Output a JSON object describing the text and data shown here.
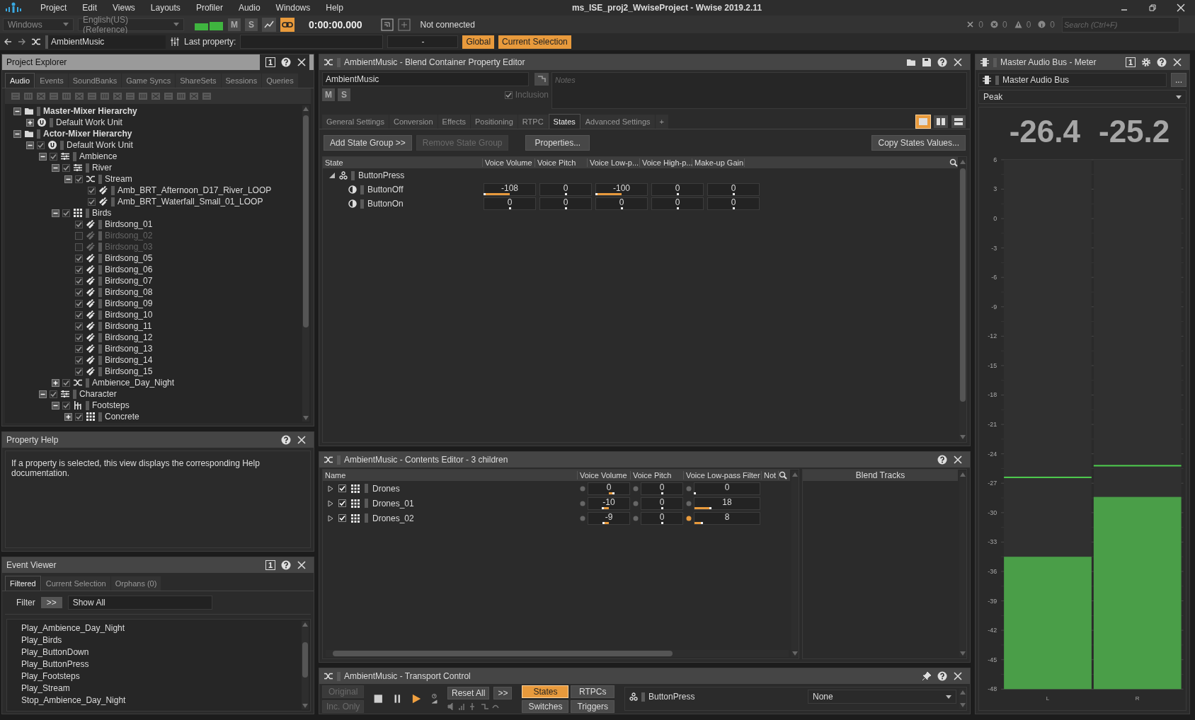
{
  "title_bar": {
    "app_title": "ms_ISE_proj2_WwiseProject - Wwise 2019.2.11"
  },
  "menu": [
    "Project",
    "Edit",
    "Views",
    "Layouts",
    "Profiler",
    "Audio",
    "Windows",
    "Help"
  ],
  "toolbar": {
    "layout": "Windows",
    "language": "English(US) (Reference)",
    "mute": {
      "label": "M",
      "on": false
    },
    "solo": {
      "label": "S",
      "on": false
    },
    "capture": {
      "on": true
    },
    "time": "0:00:00.000",
    "connection": "Not connected",
    "counts": [
      {
        "kind": "clear",
        "value": "0"
      },
      {
        "kind": "error",
        "value": "0"
      },
      {
        "kind": "warning",
        "value": "0"
      },
      {
        "kind": "info",
        "value": "0"
      }
    ],
    "search": {
      "placeholder": "Search (Ctrl+F)"
    }
  },
  "navigation": {
    "object": "AmbientMusic",
    "last_property_label": "Last property:",
    "last_property_value": "-",
    "scopes": [
      {
        "label": "Global",
        "on": true
      },
      {
        "label": "Current Selection",
        "on": true
      }
    ]
  },
  "project_explorer": {
    "title": "Project Explorer",
    "view_number": "1",
    "tabs": [
      {
        "label": "Audio",
        "selected": true
      },
      {
        "label": "Events",
        "selected": false
      },
      {
        "label": "SoundBanks",
        "selected": false
      },
      {
        "label": "Game Syncs",
        "selected": false
      },
      {
        "label": "ShareSets",
        "selected": false
      },
      {
        "label": "Sessions",
        "selected": false
      },
      {
        "label": "Queries",
        "selected": false
      }
    ],
    "tree": [
      {
        "name": "Master-Mixer Hierarchy",
        "kind": "folder",
        "expanded": true,
        "children": [
          {
            "name": "Default Work Unit",
            "kind": "work-unit",
            "expanded": false
          }
        ]
      },
      {
        "name": "Actor-Mixer Hierarchy",
        "kind": "folder",
        "expanded": true,
        "children": [
          {
            "name": "Default Work Unit",
            "kind": "work-unit",
            "checked": true,
            "expanded": true,
            "children": [
              {
                "name": "Ambience",
                "kind": "actor-mixer",
                "checked": true,
                "expanded": true,
                "children": [
                  {
                    "name": "River",
                    "kind": "actor-mixer",
                    "checked": true,
                    "expanded": true,
                    "children": [
                      {
                        "name": "Stream",
                        "kind": "random",
                        "checked": true,
                        "expanded": true,
                        "children": [
                          {
                            "name": "Amb_BRT_Afternoon_D17_River_LOOP",
                            "kind": "sound",
                            "checked": true
                          },
                          {
                            "name": "Amb_BRT_Waterfall_Small_01_LOOP",
                            "kind": "sound",
                            "checked": true
                          }
                        ]
                      }
                    ]
                  },
                  {
                    "name": "Birds",
                    "kind": "blend",
                    "checked": true,
                    "expanded": true,
                    "children": [
                      {
                        "name": "Birdsong_01",
                        "kind": "sound",
                        "checked": true
                      },
                      {
                        "name": "Birdsong_02",
                        "kind": "sound",
                        "checked": false
                      },
                      {
                        "name": "Birdsong_03",
                        "kind": "sound",
                        "checked": false
                      },
                      {
                        "name": "Birdsong_05",
                        "kind": "sound",
                        "checked": true
                      },
                      {
                        "name": "Birdsong_06",
                        "kind": "sound",
                        "checked": true
                      },
                      {
                        "name": "Birdsong_07",
                        "kind": "sound",
                        "checked": true
                      },
                      {
                        "name": "Birdsong_08",
                        "kind": "sound",
                        "checked": true
                      },
                      {
                        "name": "Birdsong_09",
                        "kind": "sound",
                        "checked": true
                      },
                      {
                        "name": "Birdsong_10",
                        "kind": "sound",
                        "checked": true
                      },
                      {
                        "name": "Birdsong_11",
                        "kind": "sound",
                        "checked": true
                      },
                      {
                        "name": "Birdsong_12",
                        "kind": "sound",
                        "checked": true
                      },
                      {
                        "name": "Birdsong_13",
                        "kind": "sound",
                        "checked": true
                      },
                      {
                        "name": "Birdsong_14",
                        "kind": "sound",
                        "checked": true
                      },
                      {
                        "name": "Birdsong_15",
                        "kind": "sound",
                        "checked": true
                      }
                    ]
                  },
                  {
                    "name": "Ambience_Day_Night",
                    "kind": "random",
                    "checked": true,
                    "expanded": false
                  }
                ]
              },
              {
                "name": "Character",
                "kind": "actor-mixer",
                "checked": true,
                "expanded": true,
                "children": [
                  {
                    "name": "Footsteps",
                    "kind": "switch",
                    "checked": true,
                    "expanded": true,
                    "children": [
                      {
                        "name": "Concrete",
                        "kind": "blend",
                        "checked": true,
                        "expanded": false
                      }
                    ]
                  }
                ]
              }
            ]
          }
        ]
      }
    ]
  },
  "property_help": {
    "title": "Property Help",
    "text": "If a property is selected, this view displays the corresponding Help documentation."
  },
  "event_viewer": {
    "title": "Event Viewer",
    "view_number": "1",
    "tabs": [
      {
        "label": "Filtered",
        "selected": true
      },
      {
        "label": "Current Selection",
        "selected": false
      },
      {
        "label": "Orphans (0)",
        "selected": false
      }
    ],
    "filter": {
      "label": "Filter",
      "button": ">>",
      "value": "Show All"
    },
    "events": [
      "Play_Ambience_Day_Night",
      "Play_Birds",
      "Play_ButtonDown",
      "Play_ButtonPress",
      "Play_Footsteps",
      "Play_Stream",
      "Stop_Ambience_Day_Night"
    ]
  },
  "property_editor": {
    "title": "AmbientMusic - Blend Container Property Editor",
    "name": "AmbientMusic",
    "mute": {
      "label": "M",
      "on": false
    },
    "solo": {
      "label": "S",
      "on": false
    },
    "inclusion": {
      "label": "Inclusion",
      "checked": true,
      "disabled": true
    },
    "notes": {
      "placeholder": "Notes"
    },
    "tabs": [
      {
        "label": "General Settings",
        "selected": false
      },
      {
        "label": "Conversion",
        "selected": false
      },
      {
        "label": "Effects",
        "selected": false
      },
      {
        "label": "Positioning",
        "selected": false
      },
      {
        "label": "RTPC",
        "selected": false
      },
      {
        "label": "States",
        "selected": true
      },
      {
        "label": "Advanced Settings",
        "selected": false
      },
      {
        "label": "+",
        "selected": false
      }
    ],
    "layouts": [
      {
        "kind": "single",
        "selected": true
      },
      {
        "kind": "columns",
        "selected": false
      },
      {
        "kind": "rows",
        "selected": false
      }
    ],
    "actions": [
      {
        "label": "Add State Group >>",
        "disabled": false
      },
      {
        "label": "Remove State Group",
        "disabled": true
      },
      {
        "label": "Properties...",
        "disabled": false
      },
      {
        "label": "Copy States Values...",
        "disabled": false
      }
    ],
    "states_table": {
      "state_column": "State",
      "columns": [
        "Voice Volume",
        "Voice Pitch",
        "Voice Low-p...",
        "Voice High-p...",
        "Make-up Gain"
      ],
      "groups": [
        {
          "name": "ButtonPress",
          "expanded": true,
          "states": [
            {
              "name": "ButtonOff",
              "cells": [
                {
                  "value": "-108",
                  "level": 0
                },
                {
                  "value": "0",
                  "level": 0.5
                },
                {
                  "value": "-100",
                  "level": 0
                },
                {
                  "value": "0",
                  "level": 0.5
                },
                {
                  "value": "0",
                  "level": 0.5
                }
              ]
            },
            {
              "name": "ButtonOn",
              "cells": [
                {
                  "value": "0",
                  "level": 0.5
                },
                {
                  "value": "0",
                  "level": 0.5
                },
                {
                  "value": "0",
                  "level": 0.5
                },
                {
                  "value": "0",
                  "level": 0.5
                },
                {
                  "value": "0",
                  "level": 0.5
                }
              ]
            }
          ]
        }
      ]
    }
  },
  "contents_editor": {
    "title": "AmbientMusic - Contents Editor - 3 children",
    "name_column": "Name",
    "columns": [
      {
        "label": "Voice Volume",
        "kind": "bipolar"
      },
      {
        "label": "Voice Pitch",
        "kind": "bipolar"
      },
      {
        "label": "Voice Low-pass Filter",
        "kind": "unipolar"
      },
      {
        "label": "Not"
      }
    ],
    "rows": [
      {
        "name": "Drones",
        "expanded": false,
        "checked": true,
        "cells": [
          {
            "value": "0",
            "level": 0.6,
            "active": false
          },
          {
            "value": "0",
            "level": 0.5,
            "active": false
          },
          {
            "value": "0",
            "level": 0,
            "active": false
          }
        ]
      },
      {
        "name": "Drones_01",
        "expanded": false,
        "checked": true,
        "cells": [
          {
            "value": "-10",
            "level": 0.35,
            "active": false
          },
          {
            "value": "0",
            "level": 0.5,
            "active": false
          },
          {
            "value": "18",
            "level": 0.24,
            "active": false
          }
        ]
      },
      {
        "name": "Drones_02",
        "expanded": false,
        "checked": true,
        "cells": [
          {
            "value": "-9",
            "level": 0.37,
            "active": false
          },
          {
            "value": "0",
            "level": 0.5,
            "active": false
          },
          {
            "value": "8",
            "level": 0.11,
            "active": true
          }
        ]
      }
    ],
    "blend_tracks": {
      "title": "Blend Tracks"
    }
  },
  "transport": {
    "title": "AmbientMusic - Transport Control",
    "modes": [
      {
        "label": "Original",
        "disabled": true
      },
      {
        "label": "Inc. Only",
        "disabled": true
      }
    ],
    "reset": "Reset All",
    "more": ">>",
    "categories": [
      {
        "label": "States",
        "selected": true
      },
      {
        "label": "RTPCs",
        "selected": false
      },
      {
        "label": "Switches",
        "selected": false
      },
      {
        "label": "Triggers",
        "selected": false
      }
    ],
    "items": [
      {
        "name": "ButtonPress",
        "value": "None"
      }
    ]
  },
  "meter": {
    "title": "Master Audio Bus - Meter",
    "view_number": "1",
    "bus": "Master Audio Bus",
    "more": "...",
    "mode": "Peak",
    "readouts": [
      "-26.4",
      "-25.2"
    ],
    "scale": [
      "6",
      "3",
      "0",
      "-3",
      "-6",
      "-9",
      "-12",
      "-15",
      "-18",
      "-21",
      "-24",
      "-27",
      "-30",
      "-33",
      "-36",
      "-39",
      "-42",
      "-45",
      "-48"
    ],
    "channels": [
      {
        "label": "L",
        "level": 0.25,
        "peak": {
          "level": 0.4
        }
      },
      {
        "label": "R",
        "level": 0.363,
        "peak": {
          "level": 0.422
        }
      }
    ]
  }
}
